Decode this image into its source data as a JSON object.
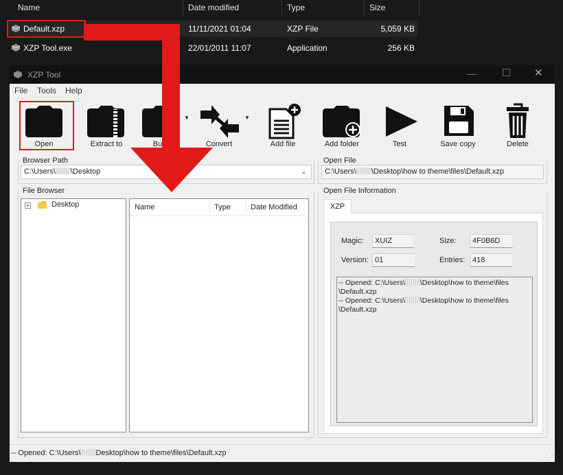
{
  "explorer": {
    "columns": [
      "Name",
      "Date modified",
      "Type",
      "Size"
    ],
    "files": [
      {
        "name": "Default.xzp",
        "date": "11/11/2021 01:04",
        "type": "XZP File",
        "size": "5,059 KB"
      },
      {
        "name": "XZP Tool.exe",
        "date": "22/01/2011 11:07",
        "type": "Application",
        "size": "256 KB"
      }
    ]
  },
  "app": {
    "title": "XZP Tool",
    "menu": [
      "File",
      "Tools",
      "Help"
    ],
    "toolbar": [
      "Open",
      "Extract to",
      "Build",
      "Convert",
      "Add file",
      "Add folder",
      "Test",
      "Save copy",
      "Delete"
    ],
    "browser_path": {
      "label": "Browser Path",
      "prefix": "C:\\Users\\",
      "suffix": "\\Desktop"
    },
    "open_file": {
      "label": "Open File",
      "prefix": "C:\\Users\\",
      "suffix": "\\Desktop\\how to theme\\files\\Default.xzp"
    },
    "file_browser": {
      "label": "File Browser",
      "tree_root": "Desktop",
      "columns": [
        "Name",
        "Type",
        "Date Modified"
      ]
    },
    "info": {
      "label": "Open File Information",
      "tab": "XZP",
      "magic_label": "Magic:",
      "magic": "XUIZ",
      "size_label": "Size:",
      "size": "4F0B6D",
      "version_label": "Version:",
      "version": "01",
      "entries_label": "Entries:",
      "entries": "418"
    },
    "log": {
      "line1a": "-- Opened:  C:\\Users\\",
      "line1b": "\\Desktop\\how to theme\\files",
      "line1c": "\\Default.xzp",
      "line2a": "-- Opened:  C:\\Users\\",
      "line2b": "\\Desktop\\how to theme\\files",
      "line2c": "\\Default.xzp"
    },
    "status": {
      "prefix": "-- Opened:  C:\\Users\\",
      "suffix": "Desktop\\how to theme\\files\\Default.xzp"
    }
  },
  "colors": {
    "highlight_red": "#e21a1a",
    "explorer_bg": "#191919",
    "window_bg": "#f0f0f0"
  }
}
